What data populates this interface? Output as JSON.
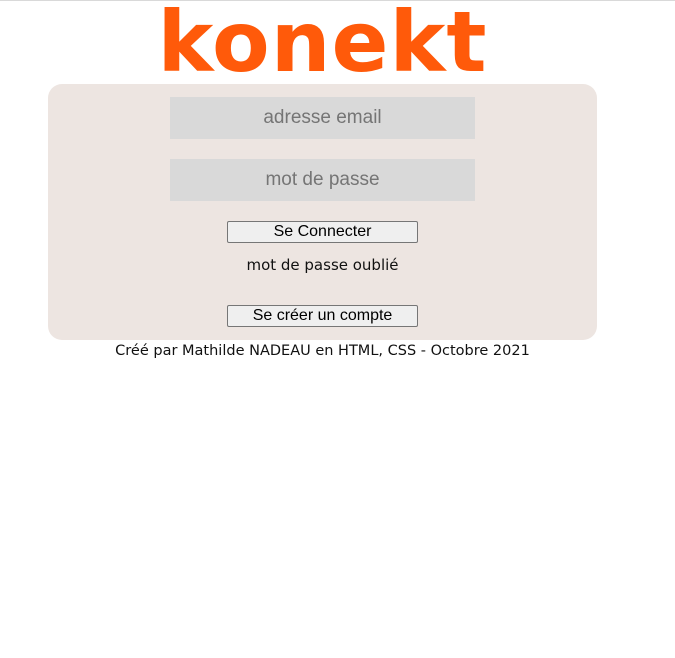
{
  "brand": {
    "logo_text": "konekt",
    "logo_color": "#ff5a0a"
  },
  "login_form": {
    "email_placeholder": "adresse email",
    "email_value": "",
    "password_placeholder": "mot de passe",
    "password_value": "",
    "login_button_label": "Se Connecter",
    "forgot_password_link": "mot de passe oublié",
    "signup_button_label": "Se créer un compte",
    "card_background": "#ede5e1",
    "field_background": "#d9d9d9"
  },
  "footer": {
    "credit_text": "Créé par Mathilde NADEAU en HTML, CSS - Octobre 2021"
  }
}
